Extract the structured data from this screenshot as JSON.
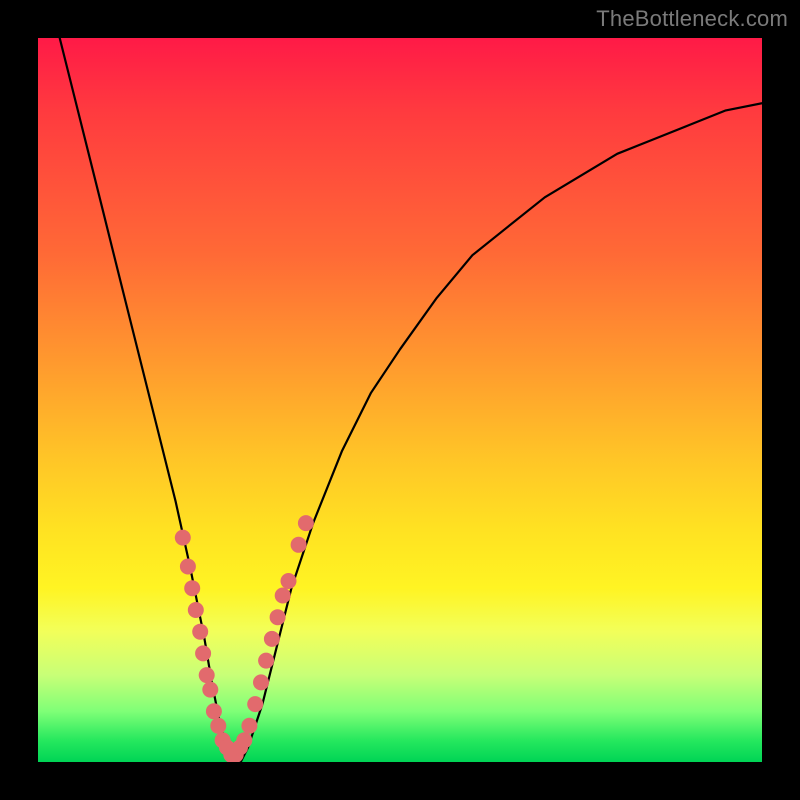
{
  "watermark": "TheBottleneck.com",
  "chart_data": {
    "type": "line",
    "title": "",
    "xlabel": "",
    "ylabel": "",
    "xlim": [
      0,
      100
    ],
    "ylim": [
      0,
      100
    ],
    "grid": false,
    "legend": false,
    "series": [
      {
        "name": "bottleneck-curve",
        "color": "#000000",
        "x": [
          3,
          5,
          7,
          9,
          11,
          13,
          15,
          17,
          19,
          21,
          23,
          24,
          25,
          26,
          27,
          28,
          29,
          31,
          33,
          35,
          38,
          42,
          46,
          50,
          55,
          60,
          65,
          70,
          75,
          80,
          85,
          90,
          95,
          100
        ],
        "y": [
          100,
          92,
          84,
          76,
          68,
          60,
          52,
          44,
          36,
          27,
          17,
          11,
          6,
          2,
          0,
          0,
          2,
          8,
          16,
          24,
          33,
          43,
          51,
          57,
          64,
          70,
          74,
          78,
          81,
          84,
          86,
          88,
          90,
          91
        ]
      }
    ],
    "markers": {
      "name": "data-points",
      "color": "#e26a6d",
      "points": [
        {
          "x": 20.0,
          "y": 31
        },
        {
          "x": 20.7,
          "y": 27
        },
        {
          "x": 21.3,
          "y": 24
        },
        {
          "x": 21.8,
          "y": 21
        },
        {
          "x": 22.4,
          "y": 18
        },
        {
          "x": 22.8,
          "y": 15
        },
        {
          "x": 23.3,
          "y": 12
        },
        {
          "x": 23.8,
          "y": 10
        },
        {
          "x": 24.3,
          "y": 7
        },
        {
          "x": 24.9,
          "y": 5
        },
        {
          "x": 25.5,
          "y": 3
        },
        {
          "x": 26.1,
          "y": 2
        },
        {
          "x": 26.7,
          "y": 1
        },
        {
          "x": 27.3,
          "y": 1
        },
        {
          "x": 27.9,
          "y": 2
        },
        {
          "x": 28.5,
          "y": 3
        },
        {
          "x": 29.2,
          "y": 5
        },
        {
          "x": 30.0,
          "y": 8
        },
        {
          "x": 30.8,
          "y": 11
        },
        {
          "x": 31.5,
          "y": 14
        },
        {
          "x": 32.3,
          "y": 17
        },
        {
          "x": 33.1,
          "y": 20
        },
        {
          "x": 33.8,
          "y": 23
        },
        {
          "x": 34.6,
          "y": 25
        },
        {
          "x": 36.0,
          "y": 30
        },
        {
          "x": 37.0,
          "y": 33
        }
      ]
    }
  }
}
